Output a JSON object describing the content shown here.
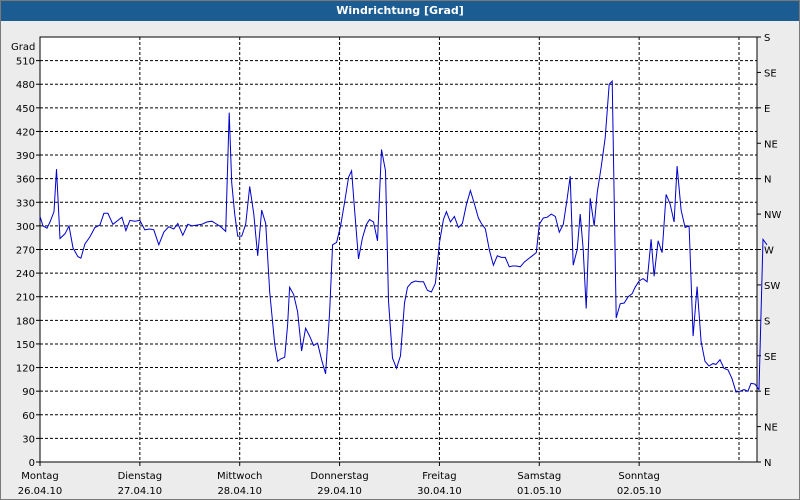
{
  "chart_data": {
    "type": "line",
    "title": "Windrichtung [Grad]",
    "ylabel": "Grad",
    "ylim": [
      0,
      540
    ],
    "yticks": [
      0,
      30,
      60,
      90,
      120,
      150,
      180,
      210,
      240,
      270,
      300,
      330,
      360,
      390,
      420,
      450,
      480,
      510
    ],
    "right_axis_labels": [
      "N",
      "NE",
      "E",
      "SE",
      "S",
      "SW",
      "W",
      "NW",
      "N",
      "NE",
      "E",
      "SE",
      "S"
    ],
    "x_categories": [
      {
        "day": "Montag",
        "date": "26.04.10"
      },
      {
        "day": "Dienstag",
        "date": "27.04.10"
      },
      {
        "day": "Mittwoch",
        "date": "28.04.10"
      },
      {
        "day": "Donnerstag",
        "date": "29.04.10"
      },
      {
        "day": "Freitag",
        "date": "30.04.10"
      },
      {
        "day": "Samstag",
        "date": "01.05.10"
      },
      {
        "day": "Sonntag",
        "date": "02.05.10"
      }
    ],
    "xlim_days": [
      0,
      7
    ],
    "grid": true,
    "line_color": "#0000cc",
    "series": [
      {
        "points": [
          [
            0.0,
            312
          ],
          [
            0.03,
            300
          ],
          [
            0.07,
            297
          ],
          [
            0.1,
            305
          ],
          [
            0.14,
            318
          ],
          [
            0.165,
            372
          ],
          [
            0.2,
            284
          ],
          [
            0.25,
            290
          ],
          [
            0.29,
            300
          ],
          [
            0.33,
            272
          ],
          [
            0.38,
            261
          ],
          [
            0.41,
            259
          ],
          [
            0.45,
            277
          ],
          [
            0.5,
            286
          ],
          [
            0.55,
            298
          ],
          [
            0.6,
            301
          ],
          [
            0.64,
            316
          ],
          [
            0.68,
            316
          ],
          [
            0.73,
            302
          ],
          [
            0.78,
            307
          ],
          [
            0.82,
            311
          ],
          [
            0.86,
            294
          ],
          [
            0.9,
            307
          ],
          [
            0.95,
            306
          ],
          [
            1.0,
            307
          ],
          [
            1.05,
            295
          ],
          [
            1.1,
            296
          ],
          [
            1.14,
            295
          ],
          [
            1.19,
            276
          ],
          [
            1.24,
            292
          ],
          [
            1.29,
            299
          ],
          [
            1.34,
            296
          ],
          [
            1.38,
            303
          ],
          [
            1.43,
            288
          ],
          [
            1.48,
            302
          ],
          [
            1.52,
            300
          ],
          [
            1.57,
            301
          ],
          [
            1.62,
            302
          ],
          [
            1.67,
            305
          ],
          [
            1.72,
            306
          ],
          [
            1.76,
            303
          ],
          [
            1.81,
            299
          ],
          [
            1.86,
            293
          ],
          [
            1.895,
            444
          ],
          [
            1.92,
            355
          ],
          [
            1.95,
            315
          ],
          [
            1.98,
            287
          ],
          [
            2.02,
            287
          ],
          [
            2.06,
            302
          ],
          [
            2.1,
            350
          ],
          [
            2.14,
            316
          ],
          [
            2.18,
            262
          ],
          [
            2.22,
            320
          ],
          [
            2.26,
            303
          ],
          [
            2.3,
            216
          ],
          [
            2.35,
            150
          ],
          [
            2.38,
            128
          ],
          [
            2.41,
            131
          ],
          [
            2.45,
            133
          ],
          [
            2.48,
            174
          ],
          [
            2.5,
            222
          ],
          [
            2.54,
            213
          ],
          [
            2.58,
            191
          ],
          [
            2.62,
            141
          ],
          [
            2.66,
            170
          ],
          [
            2.7,
            160
          ],
          [
            2.74,
            148
          ],
          [
            2.78,
            151
          ],
          [
            2.82,
            130
          ],
          [
            2.86,
            112
          ],
          [
            2.9,
            190
          ],
          [
            2.93,
            276
          ],
          [
            2.97,
            279
          ],
          [
            3.01,
            300
          ],
          [
            3.05,
            330
          ],
          [
            3.09,
            362
          ],
          [
            3.12,
            370
          ],
          [
            3.15,
            320
          ],
          [
            3.19,
            258
          ],
          [
            3.23,
            285
          ],
          [
            3.27,
            302
          ],
          [
            3.3,
            308
          ],
          [
            3.34,
            305
          ],
          [
            3.38,
            281
          ],
          [
            3.42,
            397
          ],
          [
            3.46,
            370
          ],
          [
            3.49,
            205
          ],
          [
            3.53,
            132
          ],
          [
            3.57,
            119
          ],
          [
            3.61,
            135
          ],
          [
            3.65,
            202
          ],
          [
            3.68,
            222
          ],
          [
            3.72,
            228
          ],
          [
            3.76,
            230
          ],
          [
            3.8,
            229
          ],
          [
            3.84,
            229
          ],
          [
            3.88,
            218
          ],
          [
            3.92,
            216
          ],
          [
            3.96,
            227
          ],
          [
            4.0,
            278
          ],
          [
            4.04,
            308
          ],
          [
            4.07,
            318
          ],
          [
            4.11,
            305
          ],
          [
            4.15,
            312
          ],
          [
            4.19,
            298
          ],
          [
            4.23,
            303
          ],
          [
            4.27,
            327
          ],
          [
            4.31,
            345
          ],
          [
            4.35,
            328
          ],
          [
            4.39,
            310
          ],
          [
            4.42,
            303
          ],
          [
            4.46,
            296
          ],
          [
            4.5,
            269
          ],
          [
            4.54,
            250
          ],
          [
            4.58,
            262
          ],
          [
            4.62,
            260
          ],
          [
            4.66,
            260
          ],
          [
            4.7,
            248
          ],
          [
            4.73,
            249
          ],
          [
            4.77,
            249
          ],
          [
            4.81,
            248
          ],
          [
            4.85,
            254
          ],
          [
            4.89,
            258
          ],
          [
            4.93,
            262
          ],
          [
            4.97,
            266
          ],
          [
            5.0,
            302
          ],
          [
            5.04,
            310
          ],
          [
            5.08,
            311
          ],
          [
            5.12,
            315
          ],
          [
            5.16,
            312
          ],
          [
            5.2,
            292
          ],
          [
            5.24,
            302
          ],
          [
            5.28,
            335
          ],
          [
            5.31,
            363
          ],
          [
            5.34,
            250
          ],
          [
            5.38,
            270
          ],
          [
            5.41,
            315
          ],
          [
            5.44,
            270
          ],
          [
            5.47,
            195
          ],
          [
            5.51,
            335
          ],
          [
            5.55,
            300
          ],
          [
            5.58,
            342
          ],
          [
            5.62,
            375
          ],
          [
            5.66,
            412
          ],
          [
            5.7,
            480
          ],
          [
            5.73,
            484
          ],
          [
            5.77,
            183
          ],
          [
            5.81,
            201
          ],
          [
            5.85,
            202
          ],
          [
            5.89,
            210
          ],
          [
            5.93,
            214
          ],
          [
            5.96,
            222
          ],
          [
            6.0,
            230
          ],
          [
            6.04,
            233
          ],
          [
            6.08,
            229
          ],
          [
            6.12,
            283
          ],
          [
            6.15,
            236
          ],
          [
            6.19,
            281
          ],
          [
            6.23,
            266
          ],
          [
            6.27,
            340
          ],
          [
            6.31,
            328
          ],
          [
            6.35,
            305
          ],
          [
            6.38,
            376
          ],
          [
            6.42,
            320
          ],
          [
            6.46,
            298
          ],
          [
            6.5,
            300
          ],
          [
            6.54,
            160
          ],
          [
            6.58,
            223
          ],
          [
            6.62,
            153
          ],
          [
            6.66,
            128
          ],
          [
            6.7,
            122
          ],
          [
            6.74,
            125
          ],
          [
            6.77,
            124
          ],
          [
            6.81,
            130
          ],
          [
            6.85,
            119
          ],
          [
            6.89,
            117
          ],
          [
            6.93,
            106
          ],
          [
            6.97,
            89
          ],
          [
            7.01,
            90
          ],
          [
            7.05,
            92
          ],
          [
            7.09,
            90
          ],
          [
            7.12,
            100
          ],
          [
            7.16,
            99
          ],
          [
            7.2,
            92
          ],
          [
            7.24,
            283
          ],
          [
            7.28,
            276
          ]
        ]
      }
    ]
  }
}
